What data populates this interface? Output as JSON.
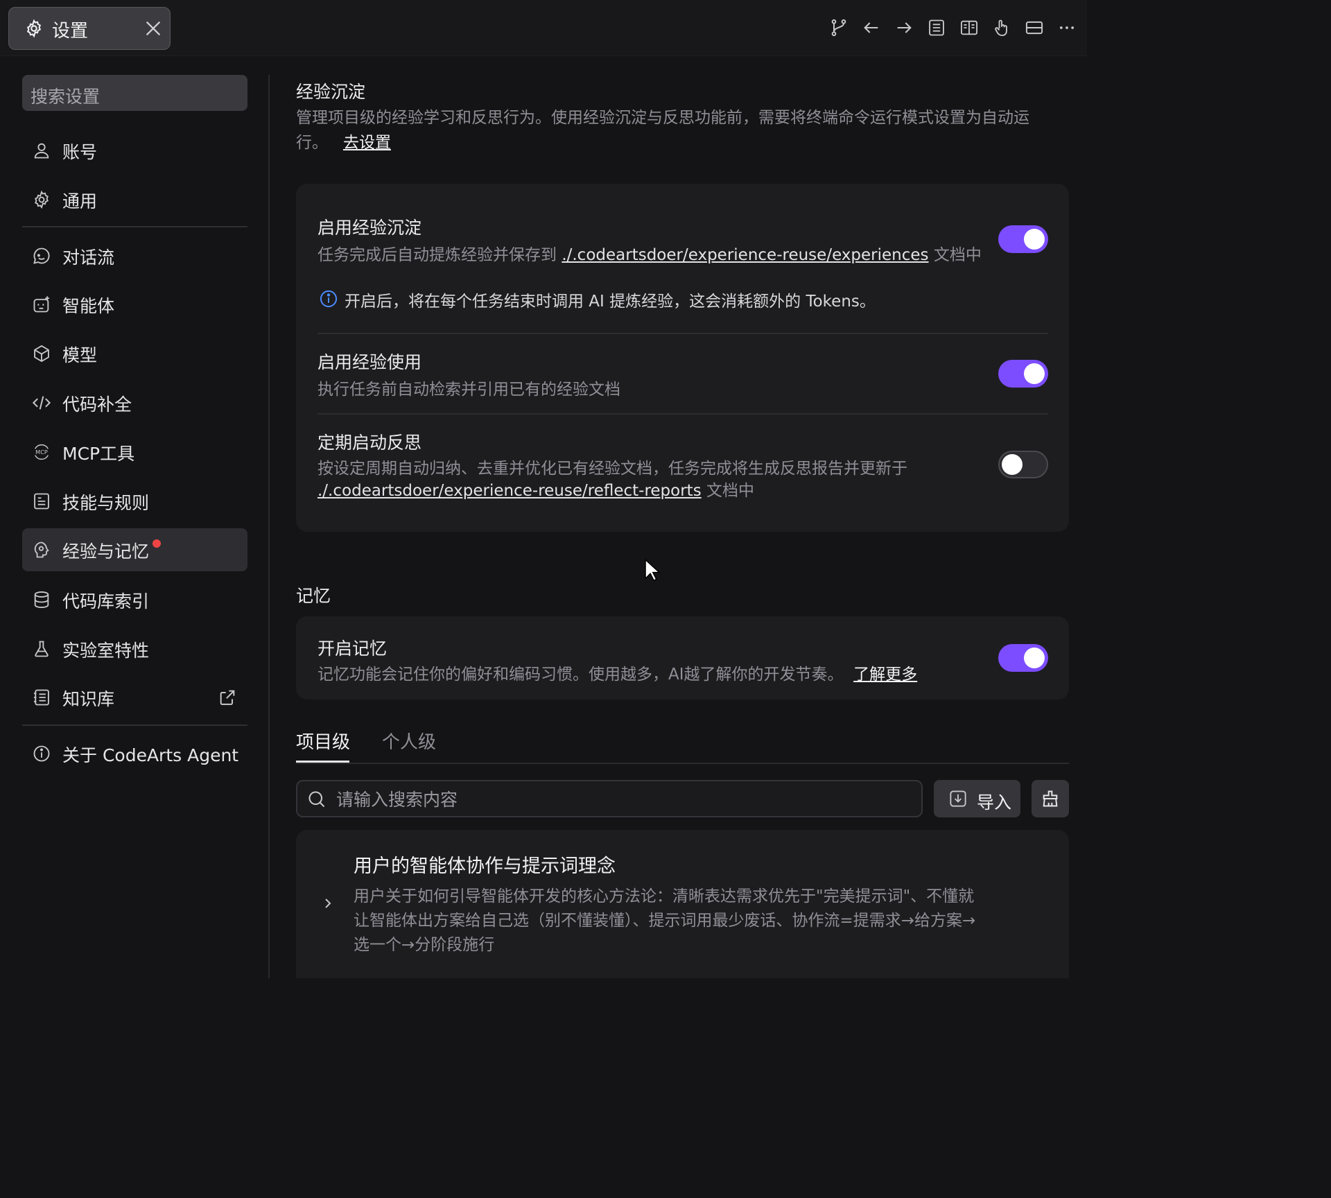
{
  "window": {
    "tab_title": "设置",
    "toolbar_icons": [
      "source-control-icon",
      "arrow-left-icon",
      "arrow-right-icon",
      "document-icon",
      "book-icon",
      "hand-pointer-icon",
      "split-icon",
      "more-icon"
    ]
  },
  "sidebar": {
    "search_placeholder": "搜索设置",
    "items": [
      {
        "label": "账号",
        "icon": "user-icon"
      },
      {
        "label": "通用",
        "icon": "gear-icon"
      },
      {
        "label": "对话流",
        "icon": "chat-icon"
      },
      {
        "label": "智能体",
        "icon": "agent-icon"
      },
      {
        "label": "模型",
        "icon": "model-icon"
      },
      {
        "label": "代码补全",
        "icon": "code-icon"
      },
      {
        "label": "MCP工具",
        "icon": "mcp-icon"
      },
      {
        "label": "技能与规则",
        "icon": "rules-icon"
      },
      {
        "label": "经验与记忆",
        "icon": "brain-icon",
        "active": true,
        "badge": true
      },
      {
        "label": "代码库索引",
        "icon": "database-icon"
      },
      {
        "label": "实验室特性",
        "icon": "flask-icon"
      },
      {
        "label": "知识库",
        "icon": "knowledge-icon",
        "external": true
      },
      {
        "label": "关于 CodeArts Agent",
        "icon": "info-icon"
      }
    ]
  },
  "experience": {
    "heading": "经验沉淀",
    "description": "管理项目级的经验学习和反思行为。使用经验沉淀与反思功能前，需要将终端命令运行模式设置为自动运行。",
    "goto_link": "去设置",
    "rows": [
      {
        "title": "启用经验沉淀",
        "desc_prefix": "任务完成后自动提炼经验并保存到",
        "path": "./.codeartsdoer/experience-reuse/experiences",
        "desc_suffix": "文档中",
        "note": "开启后，将在每个任务结束时调用 AI 提炼经验，这会消耗额外的 Tokens。",
        "enabled": true
      },
      {
        "title": "启用经验使用",
        "desc": "执行任务前自动检索并引用已有的经验文档",
        "enabled": true
      },
      {
        "title": "定期启动反思",
        "desc_prefix": "按设定周期自动归纳、去重并优化已有经验文档，任务完成将生成反思报告并更新于",
        "path": "./.codeartsdoer/experience-reuse/reflect-reports",
        "desc_suffix": "文档中",
        "enabled": false
      }
    ]
  },
  "memory": {
    "heading": "记忆",
    "toggle_title": "开启记忆",
    "toggle_desc": "记忆功能会记住你的偏好和编码习惯。使用越多，AI越了解你的开发节奏。",
    "learn_more": "了解更多",
    "enabled": true,
    "tabs": [
      {
        "label": "项目级",
        "active": true
      },
      {
        "label": "个人级",
        "active": false
      }
    ],
    "search_placeholder": "请输入搜索内容",
    "import_label": "导入",
    "entries": [
      {
        "title": "用户的智能体协作与提示词理念",
        "body": "用户关于如何引导智能体开发的核心方法论：清晰表达需求优先于\"完美提示词\"、不懂就让智能体出方案给自己选（别不懂装懂）、提示词用最少废话、协作流=提需求→给方案→选一个→分阶段施行"
      }
    ]
  },
  "colors": {
    "accent": "#7c4dff",
    "badge": "#ef4444",
    "info": "#4c8dff"
  }
}
